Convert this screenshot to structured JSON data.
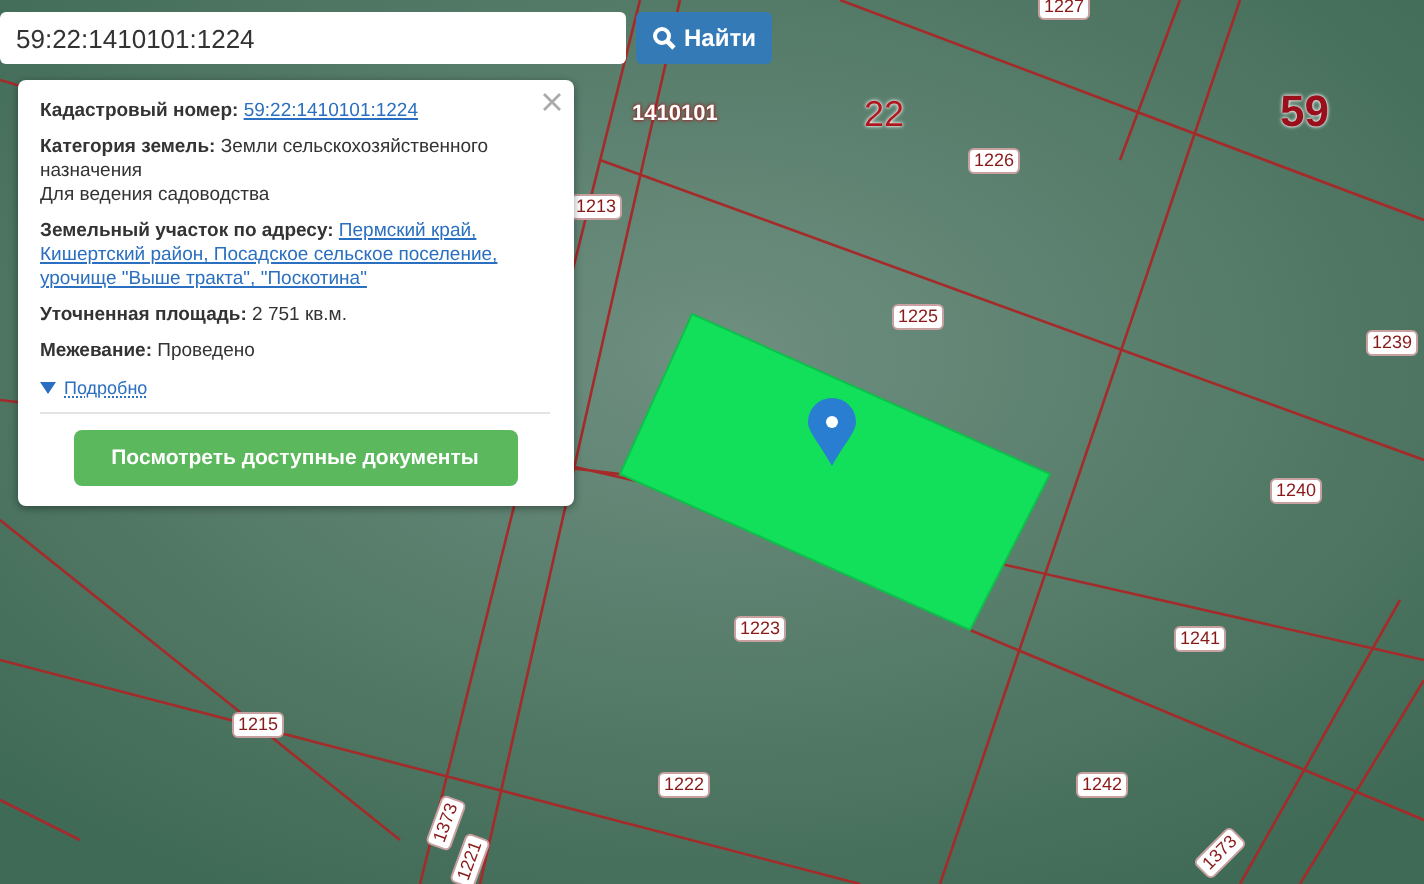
{
  "search": {
    "value": "59:22:1410101:1224",
    "button": "Найти"
  },
  "popup": {
    "fields": [
      {
        "kind": "link",
        "label": "Кадастровый номер:",
        "lines": [
          "59:22:1410101:1224"
        ]
      },
      {
        "kind": "text",
        "label": "Категория земель:",
        "lines": [
          "Земли сельскохозяйственного назначения",
          "Для ведения садоводства"
        ]
      },
      {
        "kind": "link",
        "label": "Земельный участок по адресу:",
        "lines": [
          "Пермский край,",
          "Кишертский район, Посадское сельское поселение,",
          "урочище \"Выше тракта\", \"Поскотина\""
        ]
      },
      {
        "kind": "text",
        "label": "Уточненная площадь:",
        "lines": [
          "2 751 кв.м."
        ]
      },
      {
        "kind": "text",
        "label": "Межевание:",
        "lines": [
          "Проведено"
        ]
      }
    ],
    "details": "Подробно",
    "button": "Посмотреть доступные документы"
  },
  "map": {
    "labels": [
      {
        "text": "1227",
        "kind": "parcel"
      },
      {
        "text": "1410101",
        "kind": "quarter"
      },
      {
        "text": "22",
        "kind": "district"
      },
      {
        "text": "59",
        "kind": "region"
      },
      {
        "text": "1226",
        "kind": "parcel"
      },
      {
        "text": "1213",
        "kind": "parcel"
      },
      {
        "text": "1225",
        "kind": "parcel"
      },
      {
        "text": "1239",
        "kind": "parcel"
      },
      {
        "text": "1240",
        "kind": "parcel"
      },
      {
        "text": "1241",
        "kind": "parcel"
      },
      {
        "text": "1223",
        "kind": "parcel"
      },
      {
        "text": "1222",
        "kind": "parcel"
      },
      {
        "text": "1242",
        "kind": "parcel"
      },
      {
        "text": "1215",
        "kind": "parcel"
      },
      {
        "text": "1373",
        "kind": "parcel"
      },
      {
        "text": "1221",
        "kind": "parcel"
      },
      {
        "text": "1373",
        "kind": "parcel"
      }
    ]
  }
}
